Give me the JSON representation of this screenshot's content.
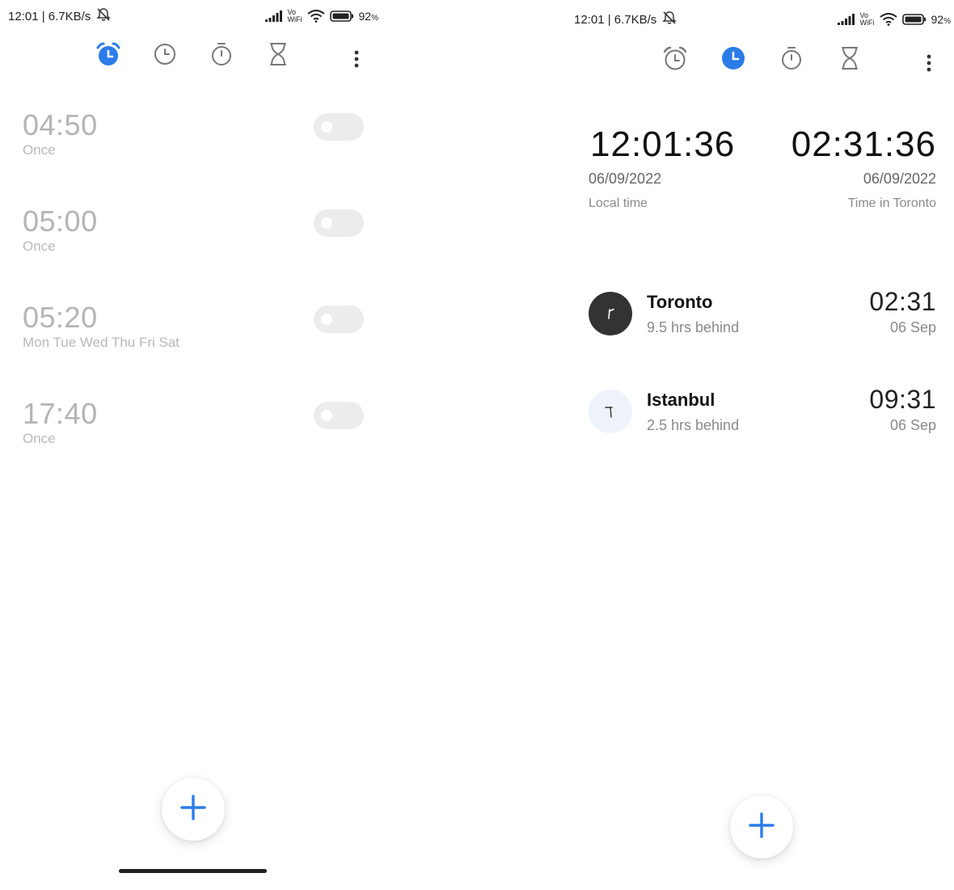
{
  "left_screen": {
    "status_bar": {
      "time_speed": "12:01 | 6.7KB/s",
      "vowifi_top": "Vo",
      "vowifi_bottom": "WiFi",
      "battery": "92",
      "battery_unit": "%"
    },
    "tabs": [
      {
        "name": "alarm",
        "icon": "alarm-clock-icon",
        "active": true
      },
      {
        "name": "world-clock",
        "icon": "clock-icon",
        "active": false
      },
      {
        "name": "stopwatch",
        "icon": "stopwatch-icon",
        "active": false
      },
      {
        "name": "timer",
        "icon": "hourglass-icon",
        "active": false
      }
    ],
    "alarms": [
      {
        "time": "04:50",
        "repeat": "Once",
        "enabled": false
      },
      {
        "time": "05:00",
        "repeat": "Once",
        "enabled": false
      },
      {
        "time": "05:20",
        "repeat": "Mon Tue Wed Thu Fri Sat",
        "enabled": false
      },
      {
        "time": "17:40",
        "repeat": "Once",
        "enabled": false
      }
    ]
  },
  "right_screen": {
    "status_bar": {
      "time_speed": "12:01 | 6.7KB/s",
      "vowifi_top": "Vo",
      "vowifi_bottom": "WiFi",
      "battery": "92",
      "battery_unit": "%"
    },
    "tabs": [
      {
        "name": "alarm",
        "icon": "alarm-clock-icon",
        "active": false
      },
      {
        "name": "world-clock",
        "icon": "clock-icon",
        "active": true
      },
      {
        "name": "stopwatch",
        "icon": "stopwatch-icon",
        "active": false
      },
      {
        "name": "timer",
        "icon": "hourglass-icon",
        "active": false
      }
    ],
    "local_clock": {
      "time": "12:01:36",
      "date": "06/09/2022",
      "label": "Local time"
    },
    "remote_clock": {
      "time": "02:31:36",
      "date": "06/09/2022",
      "label": "Time in Toronto"
    },
    "cities": [
      {
        "name": "Toronto",
        "offset": "9.5 hrs behind",
        "time": "02:31",
        "date": "06 Sep",
        "night": true
      },
      {
        "name": "Istanbul",
        "offset": "2.5 hrs behind",
        "time": "09:31",
        "date": "06 Sep",
        "night": false
      }
    ]
  },
  "colors": {
    "accent": "#2b7ce9",
    "inactive_icon": "#777777",
    "alarm_text_disabled": "#b4b4b4",
    "toggle_off": "#ececec",
    "night_avatar": "#333333",
    "day_avatar": "#eef3fb"
  }
}
